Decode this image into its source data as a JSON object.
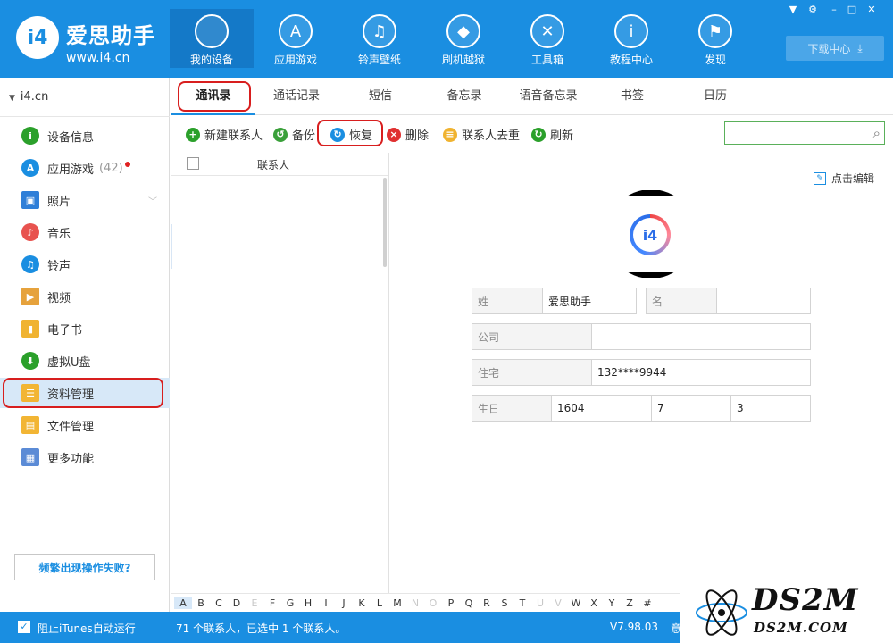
{
  "app": {
    "brand_name": "爱思助手",
    "brand_url": "www.i4.cn",
    "logo_text": "i4"
  },
  "nav": [
    {
      "label": "我的设备",
      "icon": "apple-icon",
      "glyph": ""
    },
    {
      "label": "应用游戏",
      "icon": "app-store-icon",
      "glyph": "A"
    },
    {
      "label": "铃声壁纸",
      "icon": "music-folder-icon",
      "glyph": "♫"
    },
    {
      "label": "刷机越狱",
      "icon": "dropbox-box-icon",
      "glyph": "◆"
    },
    {
      "label": "工具箱",
      "icon": "tools-icon",
      "glyph": "✕"
    },
    {
      "label": "教程中心",
      "icon": "info-icon",
      "glyph": "i"
    },
    {
      "label": "发现",
      "icon": "flag-icon",
      "glyph": "⚑"
    }
  ],
  "window_controls": [
    "shirt-icon",
    "gear-icon",
    "minimize-icon",
    "maximize-icon",
    "close-icon"
  ],
  "download": {
    "label": "下载中心",
    "icon": "download-icon"
  },
  "sidebar": {
    "device_name": "i4.cn",
    "items": [
      {
        "label": "设备信息",
        "icon": "info-circle-icon",
        "color": "#2ba02b"
      },
      {
        "label": "应用游戏",
        "icon": "app-store-icon",
        "color": "#1a8ee1",
        "count": "(42)"
      },
      {
        "label": "照片",
        "icon": "photo-icon",
        "color": "#2f7fd8"
      },
      {
        "label": "音乐",
        "icon": "music-icon",
        "color": "#e8534f"
      },
      {
        "label": "铃声",
        "icon": "bell-icon",
        "color": "#1a8ee1"
      },
      {
        "label": "视频",
        "icon": "video-icon",
        "color": "#e6a23c"
      },
      {
        "label": "电子书",
        "icon": "book-icon",
        "color": "#f0b330"
      },
      {
        "label": "虚拟U盘",
        "icon": "usb-icon",
        "color": "#2ba02b"
      },
      {
        "label": "资料管理",
        "icon": "contacts-file-icon",
        "color": "#f2b534"
      },
      {
        "label": "文件管理",
        "icon": "file-manager-icon",
        "color": "#f2b534"
      },
      {
        "label": "更多功能",
        "icon": "grid-icon",
        "color": "#5b8bd6"
      }
    ],
    "fail_button": "频繁出现操作失败?"
  },
  "tabs": [
    "通讯录",
    "通话记录",
    "短信",
    "备忘录",
    "语音备忘录",
    "书签",
    "日历"
  ],
  "toolbar": [
    {
      "label": "新建联系人",
      "icon": "plus-icon",
      "color": "#2ba02b",
      "glyph": "+"
    },
    {
      "label": "备份",
      "icon": "backup-clock-icon",
      "color": "#3aa03a",
      "glyph": "↺"
    },
    {
      "label": "恢复",
      "icon": "restore-icon",
      "color": "#1a8ee1",
      "glyph": "↻"
    },
    {
      "label": "删除",
      "icon": "delete-icon",
      "color": "#e03030",
      "glyph": "×"
    },
    {
      "label": "联系人去重",
      "icon": "contacts-dedupe-icon",
      "color": "#f0b330",
      "glyph": "≡"
    },
    {
      "label": "刷新",
      "icon": "refresh-icon",
      "color": "#2ba02b",
      "glyph": "↻"
    }
  ],
  "list": {
    "header": "联系人"
  },
  "detail": {
    "edit_label": "点击编辑",
    "surname_label": "姓",
    "surname_value": "爱思助手",
    "given_label": "名",
    "given_value": "",
    "company_label": "公司",
    "company_value": "",
    "home_label": "住宅",
    "home_value": "132****9944",
    "birthday_label": "生日",
    "birthday_year": "1604",
    "birthday_month": "7",
    "birthday_day": "3"
  },
  "alphabet": {
    "letters": [
      "A",
      "B",
      "C",
      "D",
      "E",
      "F",
      "G",
      "H",
      "I",
      "J",
      "K",
      "L",
      "M",
      "N",
      "O",
      "P",
      "Q",
      "R",
      "S",
      "T",
      "U",
      "V",
      "W",
      "X",
      "Y",
      "Z",
      "#"
    ],
    "dim": [
      "E",
      "N",
      "O",
      "U",
      "V"
    ],
    "selected": "A"
  },
  "status": {
    "itunes_label": "阻止iTunes自动运行",
    "itunes_checked": true,
    "count_text": "71 个联系人，已选中 1 个联系人。",
    "version": "V7.98.03",
    "tail": "意"
  },
  "watermark": {
    "big": "DS2M",
    "small": "DS2M.COM"
  }
}
